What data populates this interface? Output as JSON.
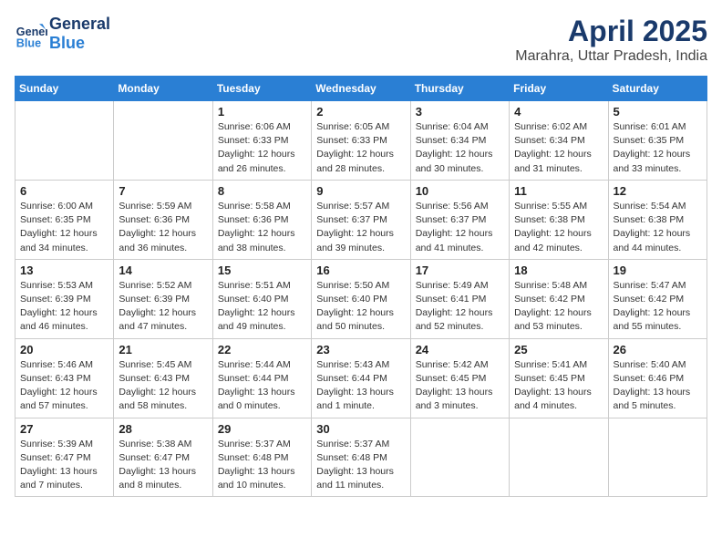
{
  "header": {
    "logo_general": "General",
    "logo_blue": "Blue",
    "month_title": "April 2025",
    "location": "Marahra, Uttar Pradesh, India"
  },
  "weekdays": [
    "Sunday",
    "Monday",
    "Tuesday",
    "Wednesday",
    "Thursday",
    "Friday",
    "Saturday"
  ],
  "weeks": [
    [
      {
        "day": "",
        "info": ""
      },
      {
        "day": "",
        "info": ""
      },
      {
        "day": "1",
        "info": "Sunrise: 6:06 AM\nSunset: 6:33 PM\nDaylight: 12 hours and 26 minutes."
      },
      {
        "day": "2",
        "info": "Sunrise: 6:05 AM\nSunset: 6:33 PM\nDaylight: 12 hours and 28 minutes."
      },
      {
        "day": "3",
        "info": "Sunrise: 6:04 AM\nSunset: 6:34 PM\nDaylight: 12 hours and 30 minutes."
      },
      {
        "day": "4",
        "info": "Sunrise: 6:02 AM\nSunset: 6:34 PM\nDaylight: 12 hours and 31 minutes."
      },
      {
        "day": "5",
        "info": "Sunrise: 6:01 AM\nSunset: 6:35 PM\nDaylight: 12 hours and 33 minutes."
      }
    ],
    [
      {
        "day": "6",
        "info": "Sunrise: 6:00 AM\nSunset: 6:35 PM\nDaylight: 12 hours and 34 minutes."
      },
      {
        "day": "7",
        "info": "Sunrise: 5:59 AM\nSunset: 6:36 PM\nDaylight: 12 hours and 36 minutes."
      },
      {
        "day": "8",
        "info": "Sunrise: 5:58 AM\nSunset: 6:36 PM\nDaylight: 12 hours and 38 minutes."
      },
      {
        "day": "9",
        "info": "Sunrise: 5:57 AM\nSunset: 6:37 PM\nDaylight: 12 hours and 39 minutes."
      },
      {
        "day": "10",
        "info": "Sunrise: 5:56 AM\nSunset: 6:37 PM\nDaylight: 12 hours and 41 minutes."
      },
      {
        "day": "11",
        "info": "Sunrise: 5:55 AM\nSunset: 6:38 PM\nDaylight: 12 hours and 42 minutes."
      },
      {
        "day": "12",
        "info": "Sunrise: 5:54 AM\nSunset: 6:38 PM\nDaylight: 12 hours and 44 minutes."
      }
    ],
    [
      {
        "day": "13",
        "info": "Sunrise: 5:53 AM\nSunset: 6:39 PM\nDaylight: 12 hours and 46 minutes."
      },
      {
        "day": "14",
        "info": "Sunrise: 5:52 AM\nSunset: 6:39 PM\nDaylight: 12 hours and 47 minutes."
      },
      {
        "day": "15",
        "info": "Sunrise: 5:51 AM\nSunset: 6:40 PM\nDaylight: 12 hours and 49 minutes."
      },
      {
        "day": "16",
        "info": "Sunrise: 5:50 AM\nSunset: 6:40 PM\nDaylight: 12 hours and 50 minutes."
      },
      {
        "day": "17",
        "info": "Sunrise: 5:49 AM\nSunset: 6:41 PM\nDaylight: 12 hours and 52 minutes."
      },
      {
        "day": "18",
        "info": "Sunrise: 5:48 AM\nSunset: 6:42 PM\nDaylight: 12 hours and 53 minutes."
      },
      {
        "day": "19",
        "info": "Sunrise: 5:47 AM\nSunset: 6:42 PM\nDaylight: 12 hours and 55 minutes."
      }
    ],
    [
      {
        "day": "20",
        "info": "Sunrise: 5:46 AM\nSunset: 6:43 PM\nDaylight: 12 hours and 57 minutes."
      },
      {
        "day": "21",
        "info": "Sunrise: 5:45 AM\nSunset: 6:43 PM\nDaylight: 12 hours and 58 minutes."
      },
      {
        "day": "22",
        "info": "Sunrise: 5:44 AM\nSunset: 6:44 PM\nDaylight: 13 hours and 0 minutes."
      },
      {
        "day": "23",
        "info": "Sunrise: 5:43 AM\nSunset: 6:44 PM\nDaylight: 13 hours and 1 minute."
      },
      {
        "day": "24",
        "info": "Sunrise: 5:42 AM\nSunset: 6:45 PM\nDaylight: 13 hours and 3 minutes."
      },
      {
        "day": "25",
        "info": "Sunrise: 5:41 AM\nSunset: 6:45 PM\nDaylight: 13 hours and 4 minutes."
      },
      {
        "day": "26",
        "info": "Sunrise: 5:40 AM\nSunset: 6:46 PM\nDaylight: 13 hours and 5 minutes."
      }
    ],
    [
      {
        "day": "27",
        "info": "Sunrise: 5:39 AM\nSunset: 6:47 PM\nDaylight: 13 hours and 7 minutes."
      },
      {
        "day": "28",
        "info": "Sunrise: 5:38 AM\nSunset: 6:47 PM\nDaylight: 13 hours and 8 minutes."
      },
      {
        "day": "29",
        "info": "Sunrise: 5:37 AM\nSunset: 6:48 PM\nDaylight: 13 hours and 10 minutes."
      },
      {
        "day": "30",
        "info": "Sunrise: 5:37 AM\nSunset: 6:48 PM\nDaylight: 13 hours and 11 minutes."
      },
      {
        "day": "",
        "info": ""
      },
      {
        "day": "",
        "info": ""
      },
      {
        "day": "",
        "info": ""
      }
    ]
  ]
}
